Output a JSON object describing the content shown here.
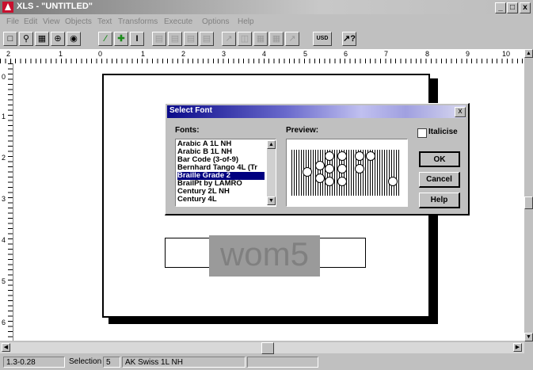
{
  "window": {
    "title": "XLS - \"UNTITLED\"",
    "min_label": "_",
    "max_label": "□",
    "close_label": "x"
  },
  "menu": [
    "File",
    "Edit",
    "View",
    "Objects",
    "Text",
    "Transforms",
    "Execute",
    "Options",
    "Help"
  ],
  "toolbar": {
    "usd_label": "USD",
    "help_label": "↗?"
  },
  "ruler": {
    "h_labels": [
      "2",
      "1",
      "0",
      "1",
      "2",
      "3",
      "4",
      "5",
      "6",
      "7",
      "8",
      "9",
      "10"
    ],
    "v_labels": [
      "0",
      "1",
      "2",
      "3",
      "4",
      "5",
      "6"
    ]
  },
  "document": {
    "selected_text": "wom5"
  },
  "dialog": {
    "title": "Select Font",
    "close_label": "x",
    "fonts_label": "Fonts:",
    "preview_label": "Preview:",
    "italicise_label": "Italicise",
    "fonts": [
      "Arabic A 1L NH",
      "Arabic B 1L NH",
      "Bar Code (3-of-9)",
      "Bernhard Tango 4L (Tr",
      "Braille Grade 2",
      "BrailPt by LAMRO",
      "Century 2L NH",
      "Century 4L"
    ],
    "selected_font": "Braille Grade 2",
    "ok_label": "OK",
    "cancel_label": "Cancel",
    "help_label": "Help"
  },
  "status": {
    "coords": "1.3-0.28",
    "selection_label": "Selection",
    "selection_count": "5",
    "font": "AK Swiss 1L NH"
  },
  "colors": {
    "list_highlight": "#000080",
    "app_icon": "#c8102e"
  }
}
